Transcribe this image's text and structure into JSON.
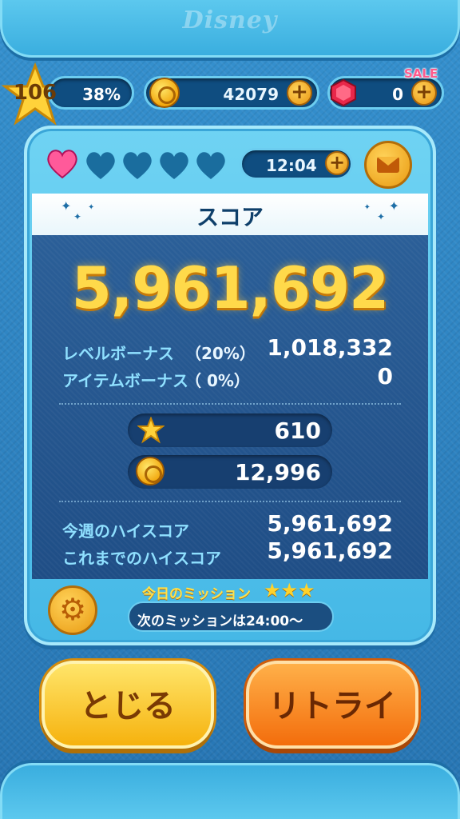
{
  "brand": {
    "logo_text": "Disney"
  },
  "status": {
    "level": "106",
    "exp_percent": "38%",
    "coins": "42079",
    "gems": "0",
    "sale_label": "SALE"
  },
  "hearts": {
    "filled": 1,
    "total": 5,
    "timer": "12:04"
  },
  "score_panel": {
    "title": "スコア",
    "score": "5,961,692",
    "level_bonus_label": "レベルボーナス",
    "level_bonus_pct": "（20%）",
    "level_bonus_value": "1,018,332",
    "item_bonus_label": "アイテムボーナス",
    "item_bonus_pct": "（ 0%）",
    "item_bonus_value": "0",
    "exp_gained": "610",
    "coins_gained": "12,996",
    "weekly_high_label": "今週のハイスコア",
    "weekly_high_value": "5,961,692",
    "alltime_high_label": "これまでのハイスコア",
    "alltime_high_value": "5,961,692"
  },
  "mission": {
    "title": "今日のミッション",
    "stars": "★★★",
    "next_text": "次のミッションは24:00〜"
  },
  "buttons": {
    "close_label": "とじる",
    "retry_label": "リトライ"
  },
  "colors": {
    "accent_gold": "#ffd94a",
    "panel_blue": "#45b8e6",
    "score_bg": "#1f4e86",
    "heart_pink": "#ff5a9a"
  },
  "icons": [
    "star-icon",
    "coin-icon",
    "gem-icon",
    "plus-icon",
    "heart-icon",
    "mail-icon",
    "gear-icon"
  ]
}
